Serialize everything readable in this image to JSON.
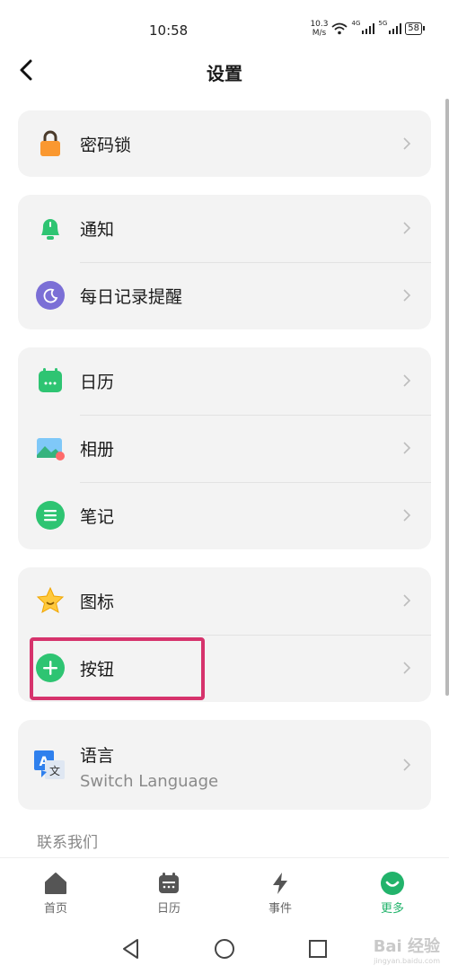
{
  "status_bar": {
    "time": "10:58",
    "speed_value": "10.3",
    "speed_unit": "M/s",
    "sig1": "4G",
    "sig2": "5G",
    "battery": "58"
  },
  "header": {
    "title": "设置"
  },
  "settings": {
    "password_lock": "密码锁",
    "notify": "通知",
    "daily_reminder": "每日记录提醒",
    "calendar": "日历",
    "album": "相册",
    "notes": "笔记",
    "icon": "图标",
    "button": "按钮",
    "language": "语言",
    "language_sub": "Switch Language"
  },
  "section": {
    "contact": "联系我们"
  },
  "tabs": [
    {
      "label": "首页"
    },
    {
      "label": "日历"
    },
    {
      "label": "事件"
    },
    {
      "label": "更多"
    }
  ],
  "watermark": {
    "text": "Bai 经验",
    "sub": "jingyan.baidu.com"
  },
  "colors": {
    "accent": "#22b36b",
    "highlight": "#d6336c",
    "card_bg": "#f3f3f3"
  }
}
